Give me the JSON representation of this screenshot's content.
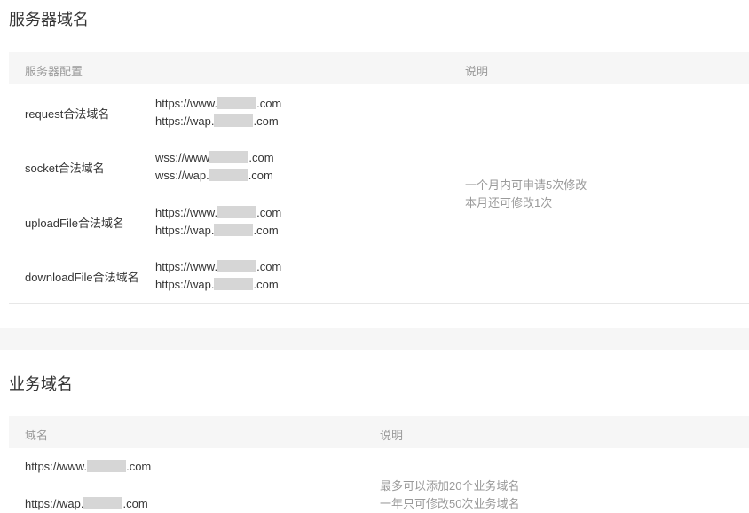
{
  "server_section": {
    "title": "服务器域名",
    "col_config": "服务器配置",
    "col_desc": "说明",
    "rows": [
      {
        "label": "request合法域名",
        "url1_pre": "https://www.",
        "url1_suf": ".com",
        "url2_pre": "https://wap.",
        "url2_suf": ".com"
      },
      {
        "label": "socket合法域名",
        "url1_pre": "wss://www",
        "url1_suf": ".com",
        "url2_pre": "wss://wap.",
        "url2_suf": ".com"
      },
      {
        "label": "uploadFile合法域名",
        "url1_pre": "https://www.",
        "url1_suf": ".com",
        "url2_pre": "https://wap.",
        "url2_suf": ".com"
      },
      {
        "label": "downloadFile合法域名",
        "url1_pre": "https://www.",
        "url1_suf": ".com",
        "url2_pre": "https://wap.",
        "url2_suf": ".com"
      }
    ],
    "note_line1": "一个月内可申请5次修改",
    "note_line2": "本月还可修改1次"
  },
  "business_section": {
    "title": "业务域名",
    "col_domain": "域名",
    "col_desc": "说明",
    "rows": [
      {
        "pre": "https://www.",
        "suf": ".com"
      },
      {
        "pre": "https://wap.",
        "suf": ".com"
      }
    ],
    "note_line1": "最多可以添加20个业务域名",
    "note_line2": "一年只可修改50次业务域名"
  }
}
